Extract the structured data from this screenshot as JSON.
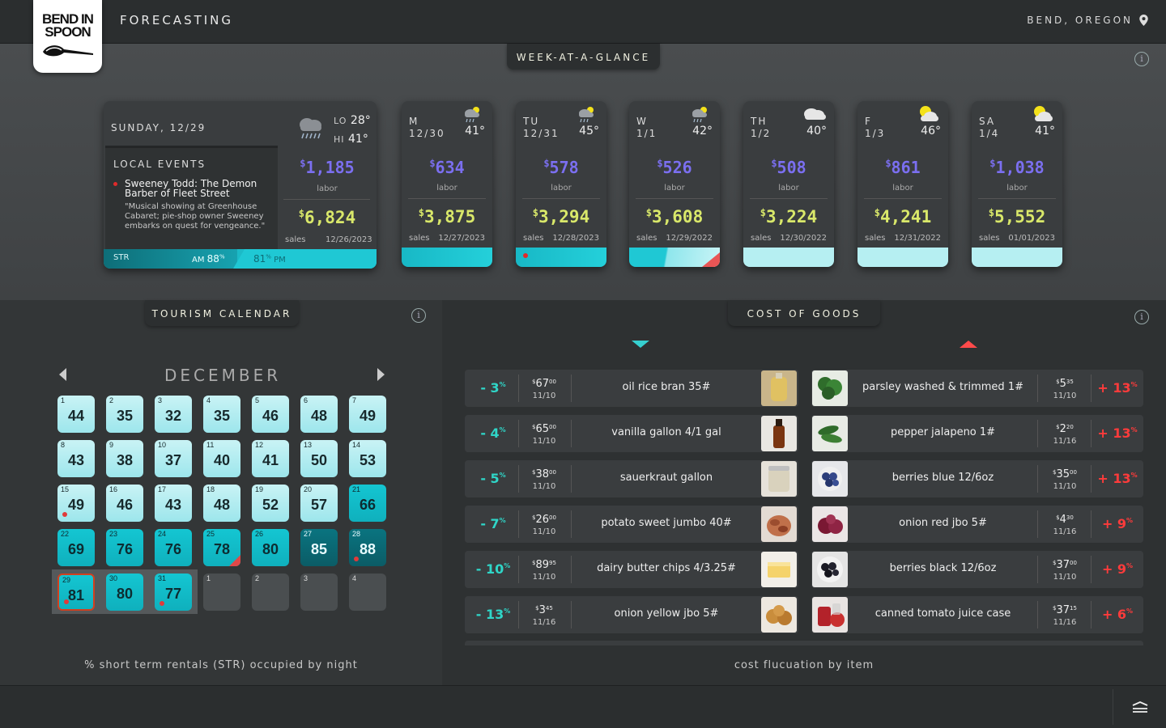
{
  "header": {
    "logo_line1": "BEND IN",
    "logo_line2": "SPOON",
    "title": "FORECASTING",
    "location": "BEND, OREGON",
    "pin_icon": "map-pin-icon"
  },
  "week": {
    "tab": "WEEK-AT-A-GLANCE",
    "info_icon": "i",
    "today": {
      "date": "SUNDAY, 12/29",
      "lo_label": "LO",
      "lo": "28°",
      "hi_label": "HI",
      "hi": "41°",
      "events_title": "LOCAL EVENTS",
      "event_title": "Sweeney Todd: The Demon Barber of Fleet Street",
      "event_desc": "\"Musical showing at Greenhouse Cabaret; pie-shop owner Sweeney embarks on quest for vengeance.\"",
      "labor": "1,185",
      "labor_label": "labor",
      "sales": "6,824",
      "sales_label": "sales",
      "sales_date": "12/26/2023",
      "str_label": "STR",
      "am_label": "AM",
      "am_pct": "88",
      "pm_pct": "81",
      "pm_label": "PM",
      "pct_sign": "%"
    },
    "days": [
      {
        "dn": "M",
        "date": "12/30",
        "temp": "41°",
        "labor": "634",
        "sales": "3,875",
        "sdate": "12/27/2023",
        "icon": "rain-sun"
      },
      {
        "dn": "TU",
        "date": "12/31",
        "temp": "45°",
        "labor": "578",
        "sales": "3,294",
        "sdate": "12/28/2023",
        "icon": "rain-sun"
      },
      {
        "dn": "W",
        "date": "1/1",
        "temp": "42°",
        "labor": "526",
        "sales": "3,608",
        "sdate": "12/29/2022",
        "icon": "rain-sun"
      },
      {
        "dn": "TH",
        "date": "1/2",
        "temp": "40°",
        "labor": "508",
        "sales": "3,224",
        "sdate": "12/30/2022",
        "icon": "cloud"
      },
      {
        "dn": "F",
        "date": "1/3",
        "temp": "46°",
        "labor": "861",
        "sales": "4,241",
        "sdate": "12/31/2022",
        "icon": "sun-cloud"
      },
      {
        "dn": "SA",
        "date": "1/4",
        "temp": "41°",
        "labor": "1,038",
        "sales": "5,552",
        "sdate": "01/01/2023",
        "icon": "sun-cloud"
      }
    ],
    "labor_label": "labor",
    "sales_label": "sales",
    "dollar": "$"
  },
  "tourism": {
    "tab": "TOURISM CALENDAR",
    "month": "DECEMBER",
    "caption": "% short term rentals (STR) occupied by night",
    "cells": [
      {
        "d": "1",
        "v": "44"
      },
      {
        "d": "2",
        "v": "35"
      },
      {
        "d": "3",
        "v": "32"
      },
      {
        "d": "4",
        "v": "35"
      },
      {
        "d": "5",
        "v": "46"
      },
      {
        "d": "6",
        "v": "48"
      },
      {
        "d": "7",
        "v": "49"
      },
      {
        "d": "8",
        "v": "43"
      },
      {
        "d": "9",
        "v": "38"
      },
      {
        "d": "10",
        "v": "37"
      },
      {
        "d": "11",
        "v": "40"
      },
      {
        "d": "12",
        "v": "41"
      },
      {
        "d": "13",
        "v": "50"
      },
      {
        "d": "14",
        "v": "53"
      },
      {
        "d": "15",
        "v": "49"
      },
      {
        "d": "16",
        "v": "46"
      },
      {
        "d": "17",
        "v": "43"
      },
      {
        "d": "18",
        "v": "48"
      },
      {
        "d": "19",
        "v": "52"
      },
      {
        "d": "20",
        "v": "57"
      },
      {
        "d": "21",
        "v": "66"
      },
      {
        "d": "22",
        "v": "69"
      },
      {
        "d": "23",
        "v": "76"
      },
      {
        "d": "24",
        "v": "76"
      },
      {
        "d": "25",
        "v": "78"
      },
      {
        "d": "26",
        "v": "80"
      },
      {
        "d": "27",
        "v": "85"
      },
      {
        "d": "28",
        "v": "88"
      },
      {
        "d": "29",
        "v": "81"
      },
      {
        "d": "30",
        "v": "80"
      },
      {
        "d": "31",
        "v": "77"
      },
      {
        "d": "1",
        "v": ""
      },
      {
        "d": "2",
        "v": ""
      },
      {
        "d": "3",
        "v": ""
      },
      {
        "d": "4",
        "v": ""
      }
    ]
  },
  "cog": {
    "tab": "COST OF GOODS",
    "caption": "cost flucuation by item",
    "down": [
      {
        "pct": "- 3",
        "dollars": "67",
        "cents": "00",
        "date": "11/10",
        "name": "oil rice bran 35#",
        "thumb": "oil"
      },
      {
        "pct": "- 4",
        "dollars": "65",
        "cents": "00",
        "date": "11/10",
        "name": "vanilla gallon 4/1 gal",
        "thumb": "vanilla"
      },
      {
        "pct": "- 5",
        "dollars": "38",
        "cents": "00",
        "date": "11/10",
        "name": "sauerkraut gallon",
        "thumb": "kraut"
      },
      {
        "pct": "- 7",
        "dollars": "26",
        "cents": "00",
        "date": "11/10",
        "name": "potato sweet jumbo 40#",
        "thumb": "potato"
      },
      {
        "pct": "- 10",
        "dollars": "89",
        "cents": "95",
        "date": "11/10",
        "name": "dairy butter chips 4/3.25#",
        "thumb": "butter"
      },
      {
        "pct": "- 13",
        "dollars": "3",
        "cents": "45",
        "date": "11/16",
        "name": "onion yellow jbo 5#",
        "thumb": "onion"
      }
    ],
    "up": [
      {
        "pct": "+ 13",
        "dollars": "5",
        "cents": "35",
        "date": "11/10",
        "name": "parsley washed & trimmed 1#",
        "thumb": "parsley"
      },
      {
        "pct": "+ 13",
        "dollars": "2",
        "cents": "20",
        "date": "11/16",
        "name": "pepper jalapeno 1#",
        "thumb": "jalapeno"
      },
      {
        "pct": "+ 13",
        "dollars": "35",
        "cents": "00",
        "date": "11/10",
        "name": "berries blue 12/6oz",
        "thumb": "blue"
      },
      {
        "pct": "+ 9",
        "dollars": "4",
        "cents": "30",
        "date": "11/16",
        "name": "onion red jbo 5#",
        "thumb": "redonion"
      },
      {
        "pct": "+ 9",
        "dollars": "37",
        "cents": "00",
        "date": "11/10",
        "name": "berries black 12/6oz",
        "thumb": "black"
      },
      {
        "pct": "+ 6",
        "dollars": "37",
        "cents": "15",
        "date": "11/16",
        "name": "canned tomato juice case",
        "thumb": "tomato"
      }
    ],
    "pct_sign": "%"
  },
  "colors": {
    "labor": "#7b6ff0",
    "sales": "#d9e86a",
    "teal": "#1fc8d4",
    "down": "#2fd6c8",
    "up": "#ff3b3b"
  },
  "footer": {
    "menu_icon": "layers-menu-icon"
  }
}
